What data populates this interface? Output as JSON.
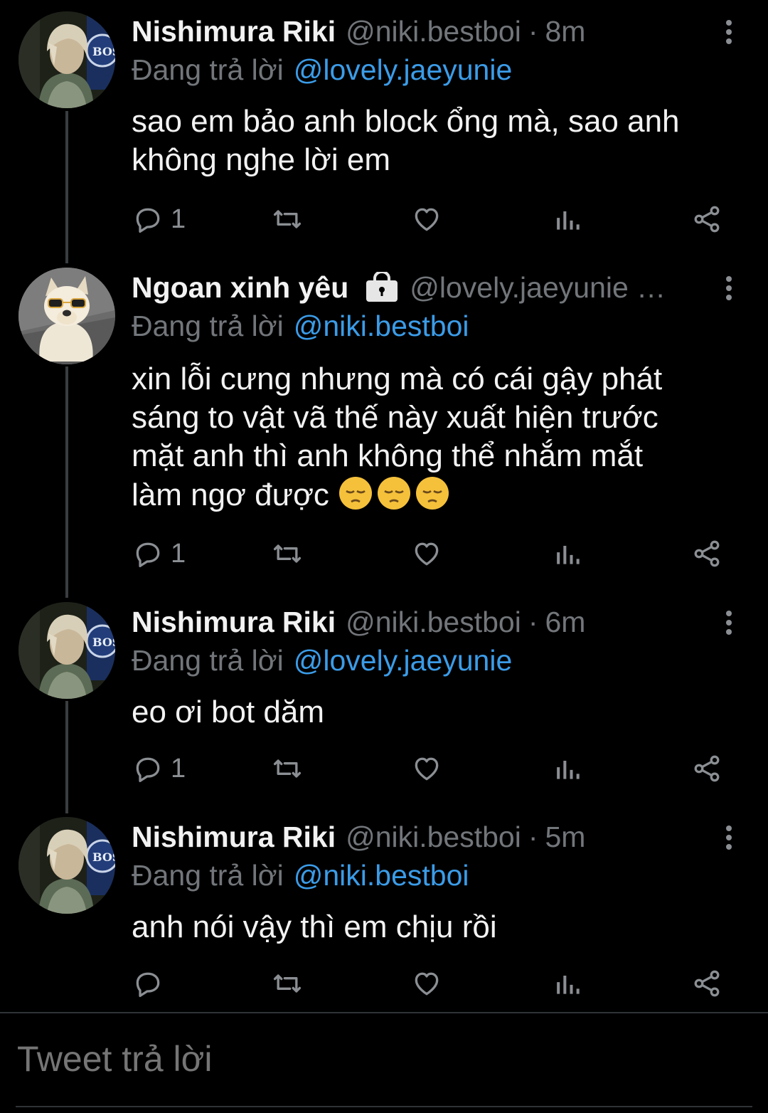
{
  "colors": {
    "background": "#000000",
    "text": "#f2f2f2",
    "muted": "#72767a",
    "link": "#3b9ce8",
    "thread_line": "#3a3d40"
  },
  "tweets": [
    {
      "name": "Nishimura Riki",
      "handle": "@niki.bestboi",
      "dot": "·",
      "time": "8m",
      "reply_prefix": "Đang trả lời",
      "reply_to": "@lovely.jaeyunie",
      "lines": [
        "sao em bảo anh block ổng mà, sao anh",
        "không nghe lời em"
      ],
      "reply_count": "1",
      "avatar": "person-avatar"
    },
    {
      "name": "Ngoan xinh yêu",
      "handle": "@lovely.jaeyunie …",
      "protected_icon": "lock-icon",
      "reply_prefix": "Đang trả lời",
      "reply_to": "@niki.bestboi",
      "lines": [
        "xin lỗi cưng nhưng mà có cái gậy phát",
        "sáng to vật vã thế này xuất hiện trước",
        "mặt anh thì anh không thể nhắm mắt",
        "làm ngơ được"
      ],
      "emojis": [
        "pensive-face-emoji",
        "pensive-face-emoji",
        "pensive-face-emoji"
      ],
      "reply_count": "1",
      "avatar": "dog-avatar"
    },
    {
      "name": "Nishimura Riki",
      "handle": "@niki.bestboi",
      "dot": "·",
      "time": "6m",
      "reply_prefix": "Đang trả lời",
      "reply_to": "@lovely.jaeyunie",
      "lines": [
        "eo ơi bot dăm"
      ],
      "reply_count": "1",
      "avatar": "person-avatar"
    },
    {
      "name": "Nishimura Riki",
      "handle": "@niki.bestboi",
      "dot": "·",
      "time": "5m",
      "reply_prefix": "Đang trả lời",
      "reply_to": "@niki.bestboi",
      "lines": [
        "anh nói vậy thì em chịu rồi"
      ],
      "reply_count": "",
      "avatar": "person-avatar"
    }
  ],
  "action_icons": [
    "reply-icon",
    "retweet-icon",
    "like-icon",
    "analytics-icon",
    "share-icon"
  ],
  "composer": {
    "placeholder": "Tweet trả lời"
  }
}
